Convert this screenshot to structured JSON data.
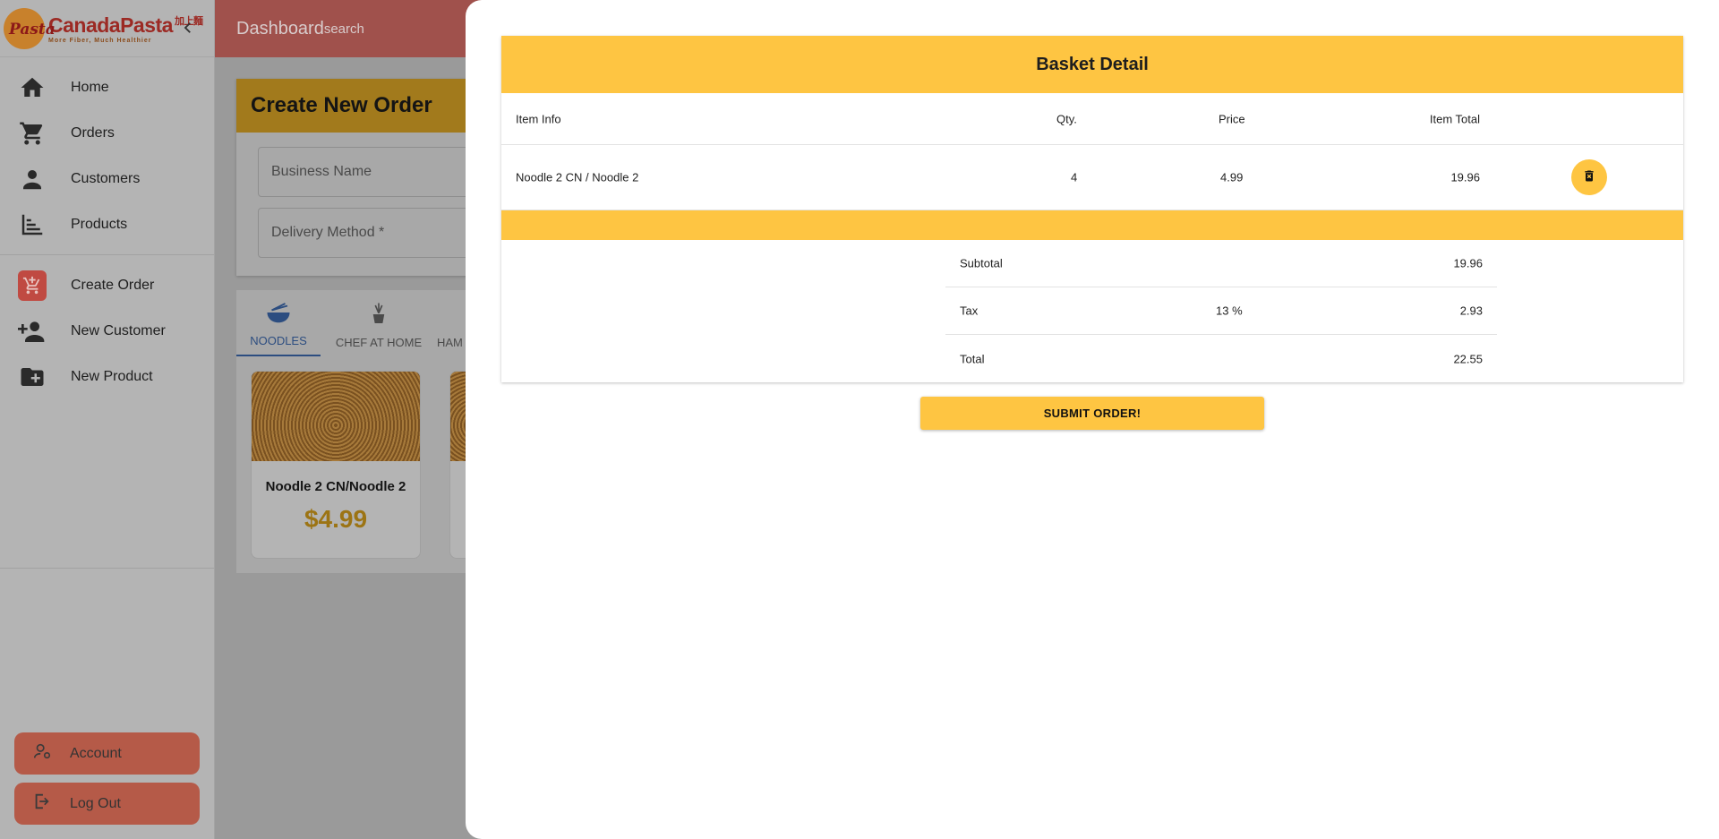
{
  "brand": {
    "logo_badge": "Pasta",
    "name": "CanadaPasta",
    "name_cn": "加上麵",
    "tagline": "More Fiber, Much Healthier"
  },
  "sidebar": {
    "nav_primary": [
      {
        "label": "Home",
        "icon": "home-icon"
      },
      {
        "label": "Orders",
        "icon": "cart-icon"
      },
      {
        "label": "Customers",
        "icon": "person-icon"
      },
      {
        "label": "Products",
        "icon": "products-icon"
      }
    ],
    "nav_secondary": [
      {
        "label": "Create Order",
        "icon": "add-cart-icon"
      },
      {
        "label": "New Customer",
        "icon": "add-person-icon"
      },
      {
        "label": "New Product",
        "icon": "add-folder-icon"
      }
    ],
    "account_label": "Account",
    "logout_label": "Log Out"
  },
  "header": {
    "title": "Dashboard",
    "search_label": "search"
  },
  "create_order": {
    "title": "Create New Order",
    "business_name_label": "Business Name",
    "delivery_method_label": "Delivery Method *"
  },
  "categories": [
    {
      "label": "NOODLES",
      "active": true
    },
    {
      "label": "CHEF AT HOME",
      "active": false
    },
    {
      "label": "HAM",
      "active": false
    }
  ],
  "products": [
    {
      "name": "Noodle 2 CN/Noodle 2",
      "price": "$4.99"
    }
  ],
  "basket": {
    "title": "Basket Detail",
    "columns": {
      "item_info": "Item Info",
      "qty": "Qty.",
      "price": "Price",
      "item_total": "Item Total"
    },
    "items": [
      {
        "info": "Noodle 2 CN / Noodle 2",
        "qty": "4",
        "price": "4.99",
        "total": "19.96"
      }
    ],
    "summary": {
      "subtotal_label": "Subtotal",
      "subtotal_value": "19.96",
      "tax_label": "Tax",
      "tax_rate": "13 %",
      "tax_value": "2.93",
      "total_label": "Total",
      "total_value": "22.55"
    },
    "submit_label": "SUBMIT ORDER!"
  },
  "colors": {
    "accent_yellow": "#fec542",
    "brand_red": "#c04a42"
  }
}
